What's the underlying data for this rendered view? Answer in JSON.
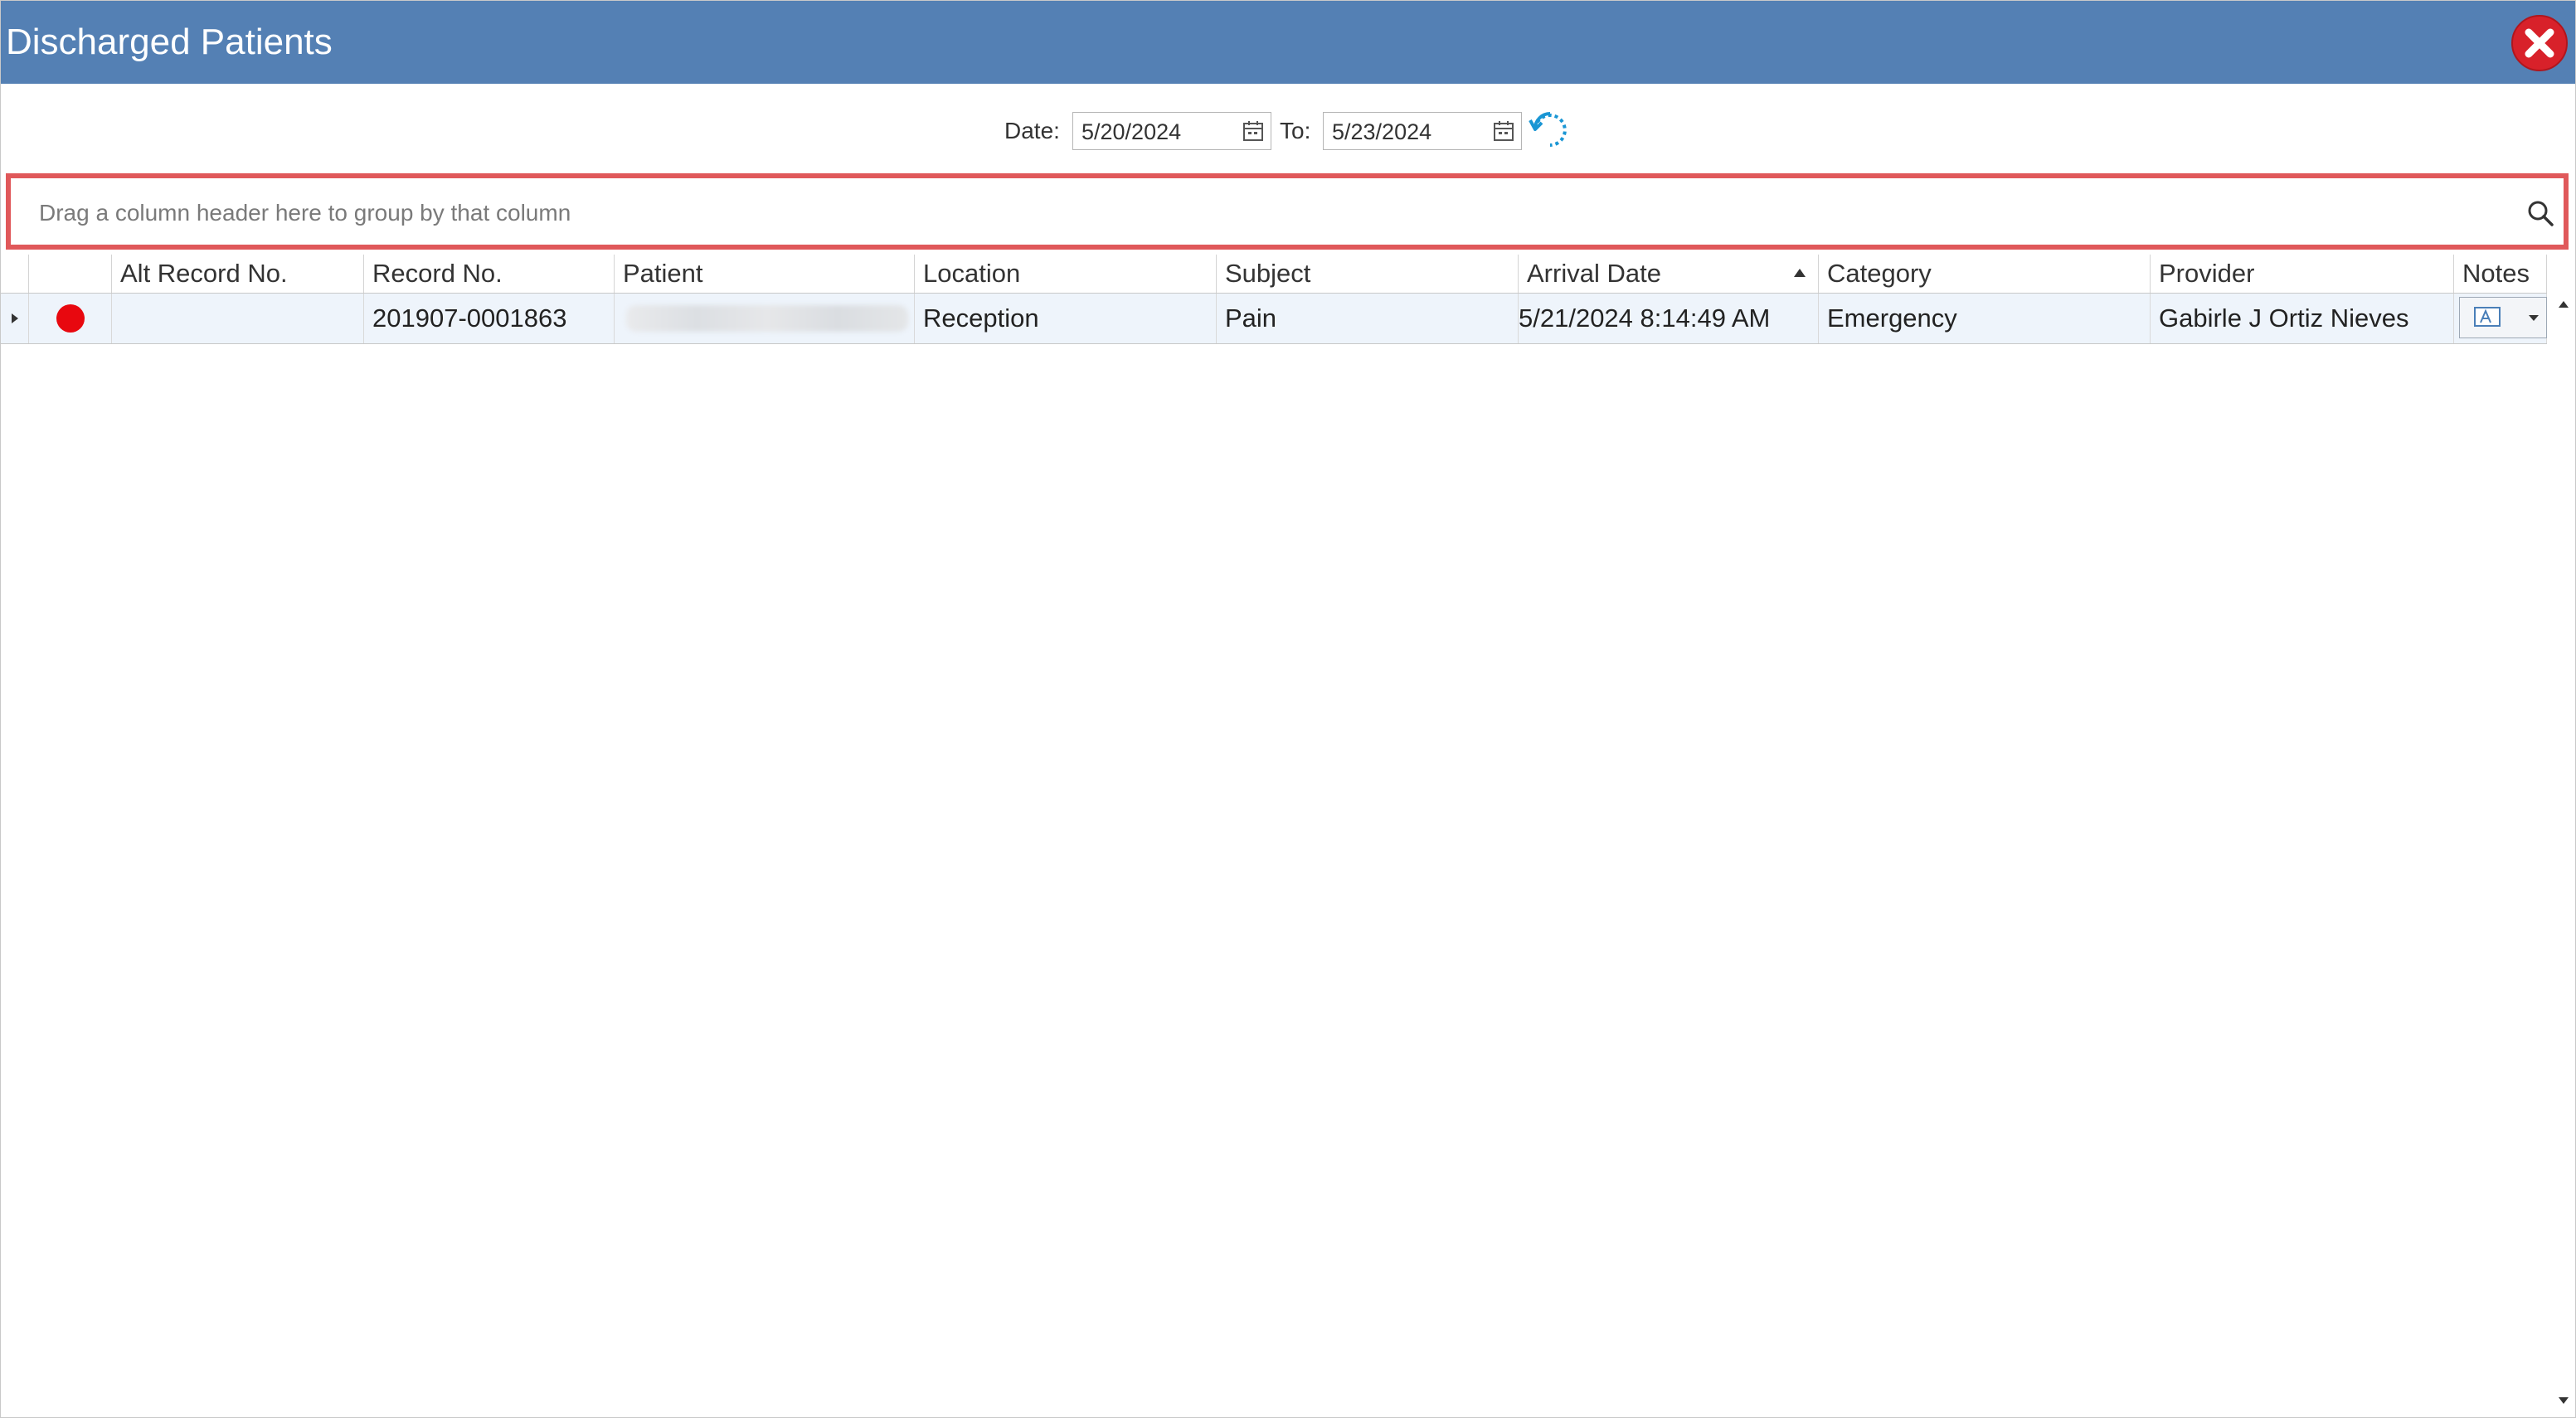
{
  "window": {
    "title": "Discharged Patients"
  },
  "filter": {
    "date_label": "Date:",
    "from_date": "5/20/2024",
    "to_label": "To:",
    "to_date": "5/23/2024"
  },
  "group_panel": {
    "hint": "Drag a column header here to group by that column"
  },
  "grid": {
    "columns": [
      "",
      "Alt Record No.",
      "Record No.",
      "Patient",
      "Location",
      "Subject",
      "Arrival Date",
      "Category",
      "Provider",
      "Notes"
    ],
    "sorted_column": "Arrival Date",
    "sort_direction": "ascending",
    "rows": [
      {
        "status_color": "#e8080f",
        "alt_record_no": "",
        "record_no": "201907-0001863",
        "patient": "",
        "location": "Reception",
        "subject": "Pain",
        "arrival_date": "5/21/2024 8:14:49 AM",
        "category": "Emergency",
        "provider": "Gabirle J Ortiz Nieves"
      }
    ]
  },
  "colors": {
    "titlebar": "#5480b4",
    "group_panel_border": "#e0585a",
    "row_highlight": "#eef4fb"
  }
}
